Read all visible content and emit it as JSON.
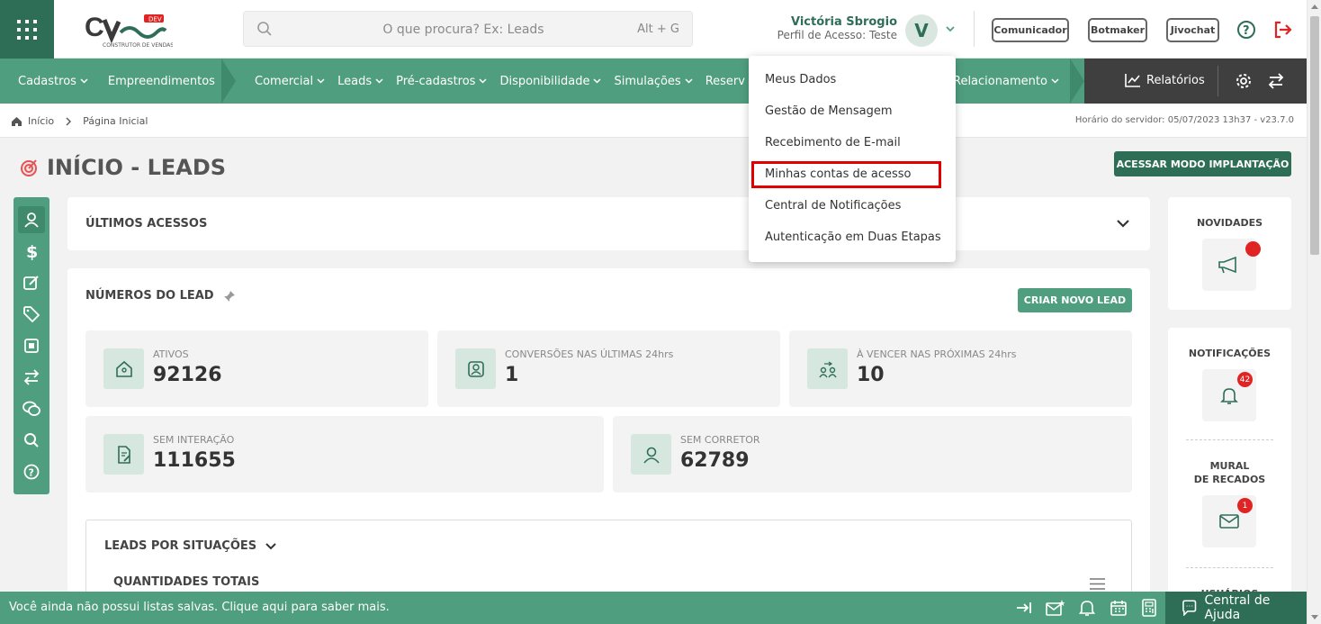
{
  "header": {
    "logo_text": "CV",
    "logo_badge": "DEV",
    "logo_subtitle": "CONSTRUTOR DE VENDAS",
    "search_placeholder": "O que procura? Ex: Leads",
    "search_shortcut": "Alt + G",
    "user_name": "Victória Sbrogio",
    "user_profile": "Perfil de Acesso: Teste",
    "avatar_letter": "V",
    "buttons": [
      "Comunicador",
      "Botmaker",
      "Jivochat"
    ]
  },
  "nav": {
    "group1": [
      "Cadastros",
      "Empreendimentos"
    ],
    "group2": [
      "Comercial",
      "Leads",
      "Pré-cadastros",
      "Disponibilidade",
      "Simulações",
      "Reserv"
    ],
    "group3": [
      "Relacionamento"
    ],
    "reports": "Relatórios"
  },
  "breadcrumb": {
    "home": "Início",
    "page": "Página Inicial",
    "server_time": "Horário do servidor: 05/07/2023 13h37 - v23.7.0"
  },
  "page": {
    "title": "INÍCIO - LEADS",
    "mode_button": "ACESSAR MODO IMPLANTAÇÃO"
  },
  "sections": {
    "last_access": "ÚLTIMOS ACESSOS",
    "lead_numbers": "NÚMEROS DO LEAD",
    "new_lead_button": "CRIAR NOVO LEAD",
    "leads_by_status": "LEADS POR SITUAÇÕES",
    "total_quantities": "QUANTIDADES TOTAIS"
  },
  "stats": [
    {
      "label": "ATIVOS",
      "value": "92126",
      "icon": "house-icon"
    },
    {
      "label": "CONVERSÕES NAS ÚLTIMAS 24hrs",
      "value": "1",
      "icon": "user-badge-icon"
    },
    {
      "label": "À VENCER NAS PRÓXIMAS 24hrs",
      "value": "10",
      "icon": "users-swap-icon"
    },
    {
      "label": "SEM INTERAÇÃO",
      "value": "111655",
      "icon": "document-edit-icon"
    },
    {
      "label": "SEM CORRETOR",
      "value": "62789",
      "icon": "user-icon"
    }
  ],
  "right_panel": {
    "news": "NOVIDADES",
    "notifications": "NOTIFICAÇÕES",
    "notifications_count": "42",
    "board_line1": "MURAL",
    "board_line2": "DE RECADOS",
    "board_count": "1",
    "users_partial": "USUÁRIOS"
  },
  "user_menu": {
    "items": [
      "Meus Dados",
      "Gestão de Mensagem",
      "Recebimento de E-mail",
      "Minhas contas de acesso",
      "Central de Notificações",
      "Autenticação em Duas Etapas"
    ],
    "highlighted_index": 3
  },
  "footer": {
    "message": "Você ainda não possui listas salvas. Clique aqui para saber mais.",
    "help": "Central de Ajuda"
  },
  "colors": {
    "primary_dark": "#2e6e57",
    "primary": "#4f9e7f",
    "nav_dark": "#3f3f3f",
    "highlight": "#e00000",
    "badge": "#e02424"
  }
}
